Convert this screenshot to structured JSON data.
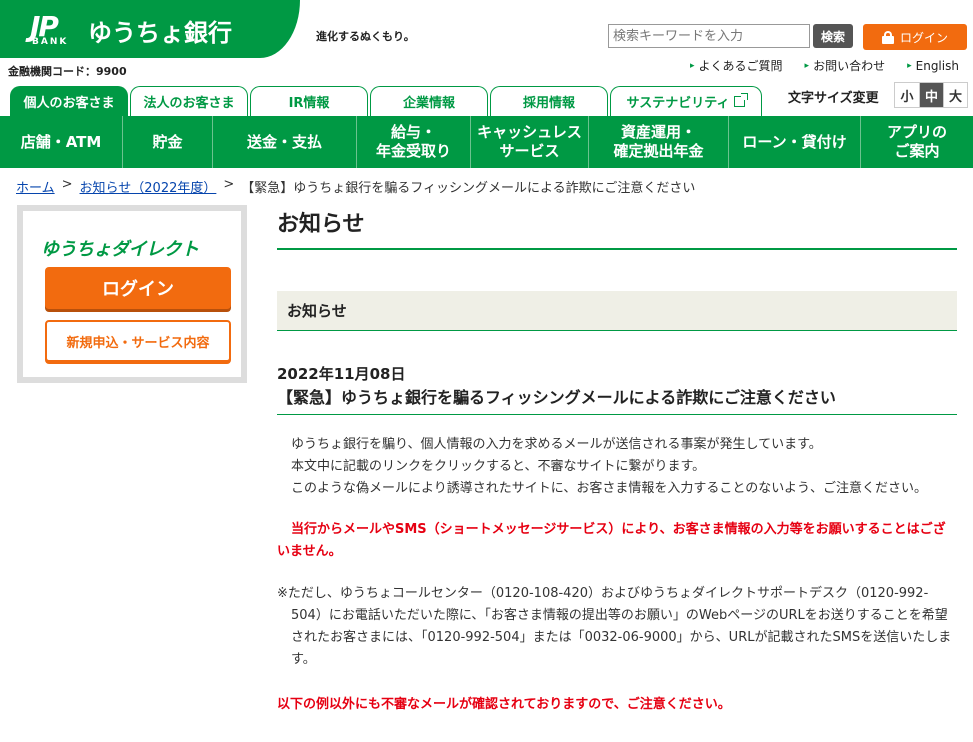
{
  "header": {
    "logo_jp": "JP",
    "logo_bank": "BANK",
    "logo_name": "ゆうちょ銀行",
    "tagline": "進化するぬくもり。",
    "bank_code": "金融機関コード：9900",
    "search": {
      "placeholder": "検索キーワードを入力",
      "button": "検索"
    },
    "login": "ログイン",
    "utility_links": [
      "よくあるご質問",
      "お問い合わせ",
      "English"
    ]
  },
  "tabs": [
    {
      "label": "個人のお客さま",
      "active": true
    },
    {
      "label": "法人のお客さま"
    },
    {
      "label": "IR情報"
    },
    {
      "label": "企業情報"
    },
    {
      "label": "採用情報"
    },
    {
      "label": "サステナビリティ"
    }
  ],
  "font_size": {
    "label": "文字サイズ変更",
    "options": [
      "小",
      "中",
      "大"
    ],
    "selected": "中"
  },
  "nav": [
    "店舗・ATM",
    "貯金",
    "送金・支払",
    "給与・\n年金受取り",
    "キャッシュレス\nサービス",
    "資産運用・\n確定拠出年金",
    "ローン・貸付け",
    "アプリの\nご案内"
  ],
  "breadcrumb": {
    "home": "ホーム",
    "parent": "お知らせ（2022年度）",
    "current": "【緊急】ゆうちょ銀行を騙るフィッシングメールによる詐欺にご注意ください"
  },
  "sidebar": {
    "logo": "ゆうちょダイレクト",
    "login": "ログイン",
    "apply": "新規申込・サービス内容"
  },
  "main": {
    "title": "お知らせ",
    "section": "お知らせ",
    "date": "2022年11月08日",
    "headline": "【緊急】ゆうちょ銀行を騙るフィッシングメールによる詐欺にご注意ください",
    "paragraphs": [
      "ゆうちょ銀行を騙り、個人情報の入力を求めるメールが送信される事案が発生しています。",
      "本文中に記載のリンクをクリックすると、不審なサイトに繋がります。",
      "このような偽メールにより誘導されたサイトに、お客さま情報を入力することのないよう、ご注意ください。"
    ],
    "warning": "当行からメールやSMS（ショートメッセージサービス）により、お客さま情報の入力等をお願いすることはございません。",
    "note": "※ただし、ゆうちょコールセンター（0120-108-420）およびゆうちょダイレクトサポートデスク（0120-992-504）にお電話いただいた際に、「お客さま情報の提出等のお願い」のWebページのURLをお送りすることを希望されたお客さまには、「0120-992-504」または「0032-06-9000」から、URLが記載されたSMSを送信いたします。",
    "warning2": "以下の例以外にも不審なメールが確認されておりますので、ご注意ください。"
  },
  "colors": {
    "brand_green": "#009944",
    "accent_orange": "#f26b0f",
    "alert_red": "#e60012"
  }
}
